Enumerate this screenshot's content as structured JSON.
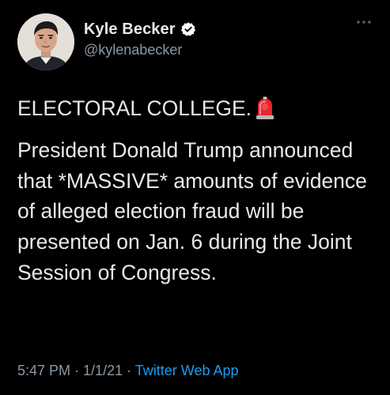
{
  "author": {
    "display_name": "Kyle Becker",
    "handle": "@kylenabecker",
    "verified": true,
    "verified_color": "#ffffff"
  },
  "icons": {
    "verified": "verified-badge-icon",
    "more": "more-options-icon",
    "emoji": "rotating-light-emoji-icon"
  },
  "tweet": {
    "line1": "ELECTORAL COLLEGE.",
    "paragraph": "President Donald Trump announced that *MASSIVE* amounts of evidence of alleged election fraud will be presented on Jan. 6 during the Joint Session of Congress."
  },
  "meta": {
    "time": "5:47 PM",
    "separator1": " · ",
    "date": "1/1/21",
    "separator2": " · ",
    "source": "Twitter Web App"
  },
  "colors": {
    "background": "#000000",
    "text": "#e7e9ea",
    "secondary": "#8b98a5",
    "accent": "#1d9bf0"
  }
}
